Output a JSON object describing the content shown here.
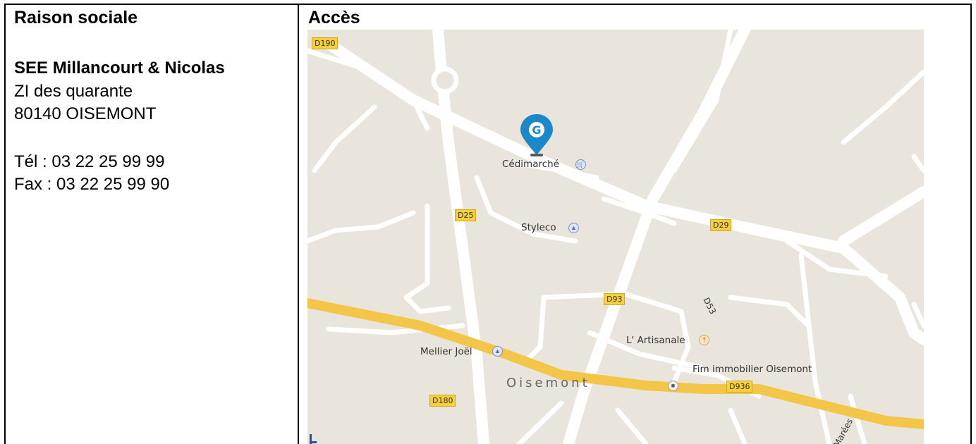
{
  "header": {
    "col1": "Raison sociale",
    "col2": "Accès"
  },
  "company": {
    "name": "SEE Millancourt & Nicolas",
    "address1": "ZI des quarante",
    "address2": "80140 OISEMONT",
    "phone": "Tél : 03 22 25 99 99",
    "fax": "Fax : 03 22 25 99 90"
  },
  "map": {
    "roads": [
      "D190",
      "D25",
      "D29",
      "D93",
      "D53",
      "D180",
      "D936"
    ],
    "places": {
      "cedimarche": "Cédimarché",
      "styleco": "Styleco",
      "artisanale": "L' Artisanale",
      "mellier": "Mellier Joël",
      "fim": "Fim immobilier Oisemont",
      "town": "Oisemont",
      "marees": "Marées"
    },
    "colors": {
      "land": "#e9e5dc",
      "road": "#ffffff",
      "highway": "#f3c64a",
      "pin": "#1a88c9"
    }
  }
}
